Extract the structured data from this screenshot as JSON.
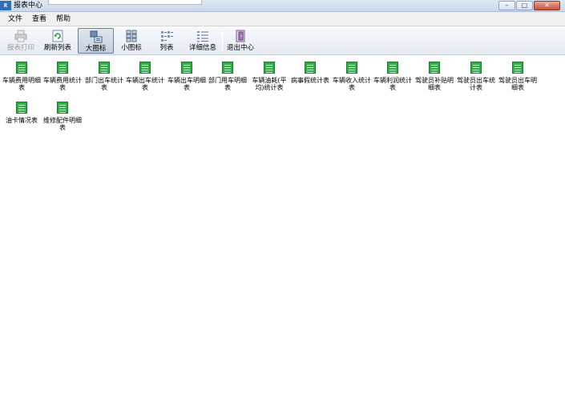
{
  "window": {
    "title": "报表中心"
  },
  "menu": [
    "文件",
    "查看",
    "帮助"
  ],
  "toolbar": {
    "print": "报表打印",
    "refresh": "刷新列表",
    "large_icons": "大图标",
    "small_icons": "小图标",
    "list": "列表",
    "details": "详细信息",
    "exit": "退出中心"
  },
  "reports": [
    "车辆费用明细表",
    "车辆费用统计表",
    "部门出车统计表",
    "车辆出车统计表",
    "车辆出车明细表",
    "部门用车明细表",
    "车辆油耗(平均)统计表",
    "病事假统计表",
    "车辆收入统计表",
    "车辆利润统计表",
    "驾驶员补贴明细表",
    "驾驶员出车统计表",
    "驾驶员出车明细表",
    "油卡情况表",
    "维修配件明细表"
  ],
  "colors": {
    "report_icon": "#2fae45",
    "titlebar": "#c9d8ea",
    "toolbar": "#e5eaf1"
  }
}
